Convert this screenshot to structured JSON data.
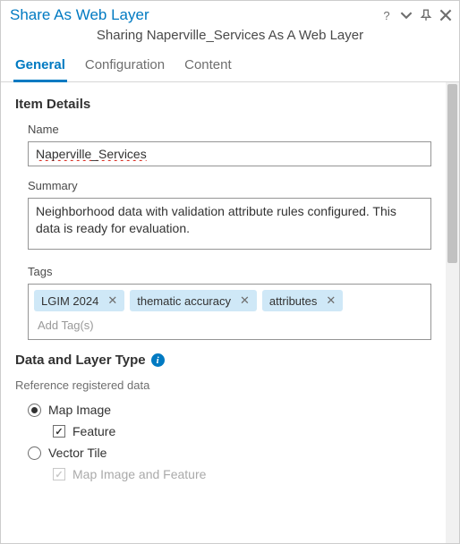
{
  "window": {
    "title": "Share As Web Layer",
    "subtitle": "Sharing Naperville_Services As A Web Layer"
  },
  "tabs": [
    {
      "label": "General",
      "active": true
    },
    {
      "label": "Configuration",
      "active": false
    },
    {
      "label": "Content",
      "active": false
    }
  ],
  "itemDetails": {
    "heading": "Item Details",
    "nameLabel": "Name",
    "nameValue": "Naperville_Services",
    "summaryLabel": "Summary",
    "summaryValue": "Neighborhood data with validation attribute rules configured. This data is ready for evaluation.",
    "tagsLabel": "Tags",
    "tags": [
      "LGIM 2024",
      "thematic accuracy",
      "attributes"
    ],
    "tagsPlaceholder": "Add Tag(s)"
  },
  "dataLayer": {
    "heading": "Data and Layer Type",
    "helper": "Reference registered data",
    "options": {
      "mapImage": {
        "label": "Map Image",
        "selected": true
      },
      "feature": {
        "label": "Feature",
        "checked": true
      },
      "vectorTile": {
        "label": "Vector Tile",
        "selected": false
      },
      "mapImageAndFeature": {
        "label": "Map Image and Feature",
        "checked": true,
        "disabled": true
      }
    }
  }
}
